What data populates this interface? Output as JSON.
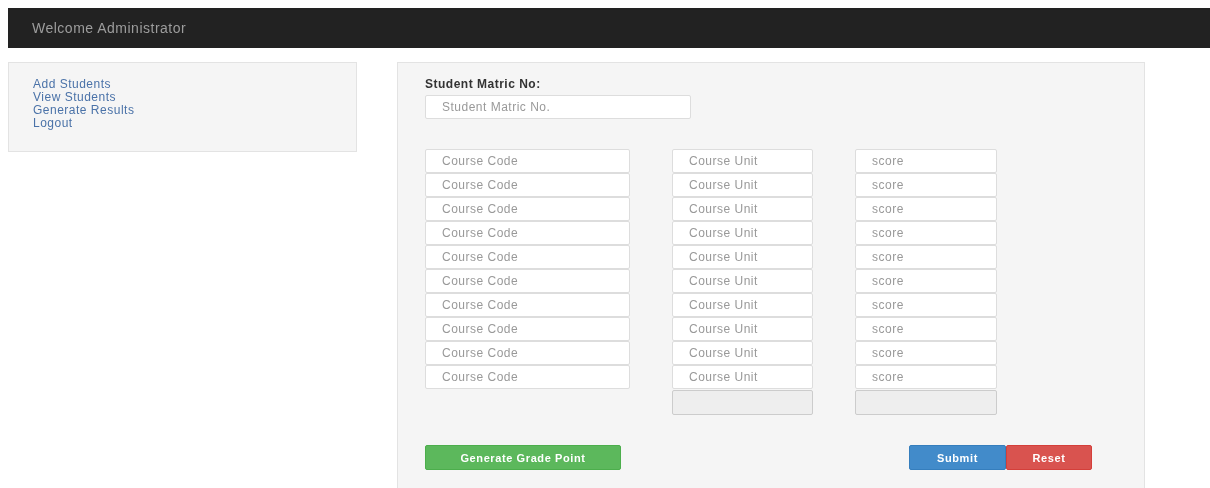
{
  "header": {
    "title": "Welcome Administrator"
  },
  "sidebar": {
    "items": [
      {
        "label": "Add Students"
      },
      {
        "label": "View Students"
      },
      {
        "label": "Generate Results"
      },
      {
        "label": "Logout"
      }
    ]
  },
  "form": {
    "matric_label": "Student Matric No:",
    "matric_field": {
      "placeholder": "Student Matric No."
    },
    "rows": [
      {
        "fields": [
          {
            "placeholder": "Course Code"
          },
          {
            "placeholder": "Course Unit"
          },
          {
            "placeholder": "score"
          }
        ]
      },
      {
        "fields": [
          {
            "placeholder": "Course Code"
          },
          {
            "placeholder": "Course Unit"
          },
          {
            "placeholder": "score"
          }
        ]
      },
      {
        "fields": [
          {
            "placeholder": "Course Code"
          },
          {
            "placeholder": "Course Unit"
          },
          {
            "placeholder": "score"
          }
        ]
      },
      {
        "fields": [
          {
            "placeholder": "Course Code"
          },
          {
            "placeholder": "Course Unit"
          },
          {
            "placeholder": "score"
          }
        ]
      },
      {
        "fields": [
          {
            "placeholder": "Course Code"
          },
          {
            "placeholder": "Course Unit"
          },
          {
            "placeholder": "score"
          }
        ]
      },
      {
        "fields": [
          {
            "placeholder": "Course Code"
          },
          {
            "placeholder": "Course Unit"
          },
          {
            "placeholder": "score"
          }
        ]
      },
      {
        "fields": [
          {
            "placeholder": "Course Code"
          },
          {
            "placeholder": "Course Unit"
          },
          {
            "placeholder": "score"
          }
        ]
      },
      {
        "fields": [
          {
            "placeholder": "Course Code"
          },
          {
            "placeholder": "Course Unit"
          },
          {
            "placeholder": "score"
          }
        ]
      },
      {
        "fields": [
          {
            "placeholder": "Course Code"
          },
          {
            "placeholder": "Course Unit"
          },
          {
            "placeholder": "score"
          }
        ]
      },
      {
        "fields": [
          {
            "placeholder": "Course Code"
          },
          {
            "placeholder": "Course Unit"
          },
          {
            "placeholder": "score"
          }
        ]
      }
    ],
    "total_unit_field": {
      "disabled": true
    },
    "total_score_field": {
      "disabled": true
    },
    "buttons": [
      {
        "kind": "success",
        "label": "Generate Grade Point"
      },
      {
        "kind": "primary",
        "label": "Submit"
      },
      {
        "kind": "danger",
        "label": "Reset"
      }
    ]
  }
}
